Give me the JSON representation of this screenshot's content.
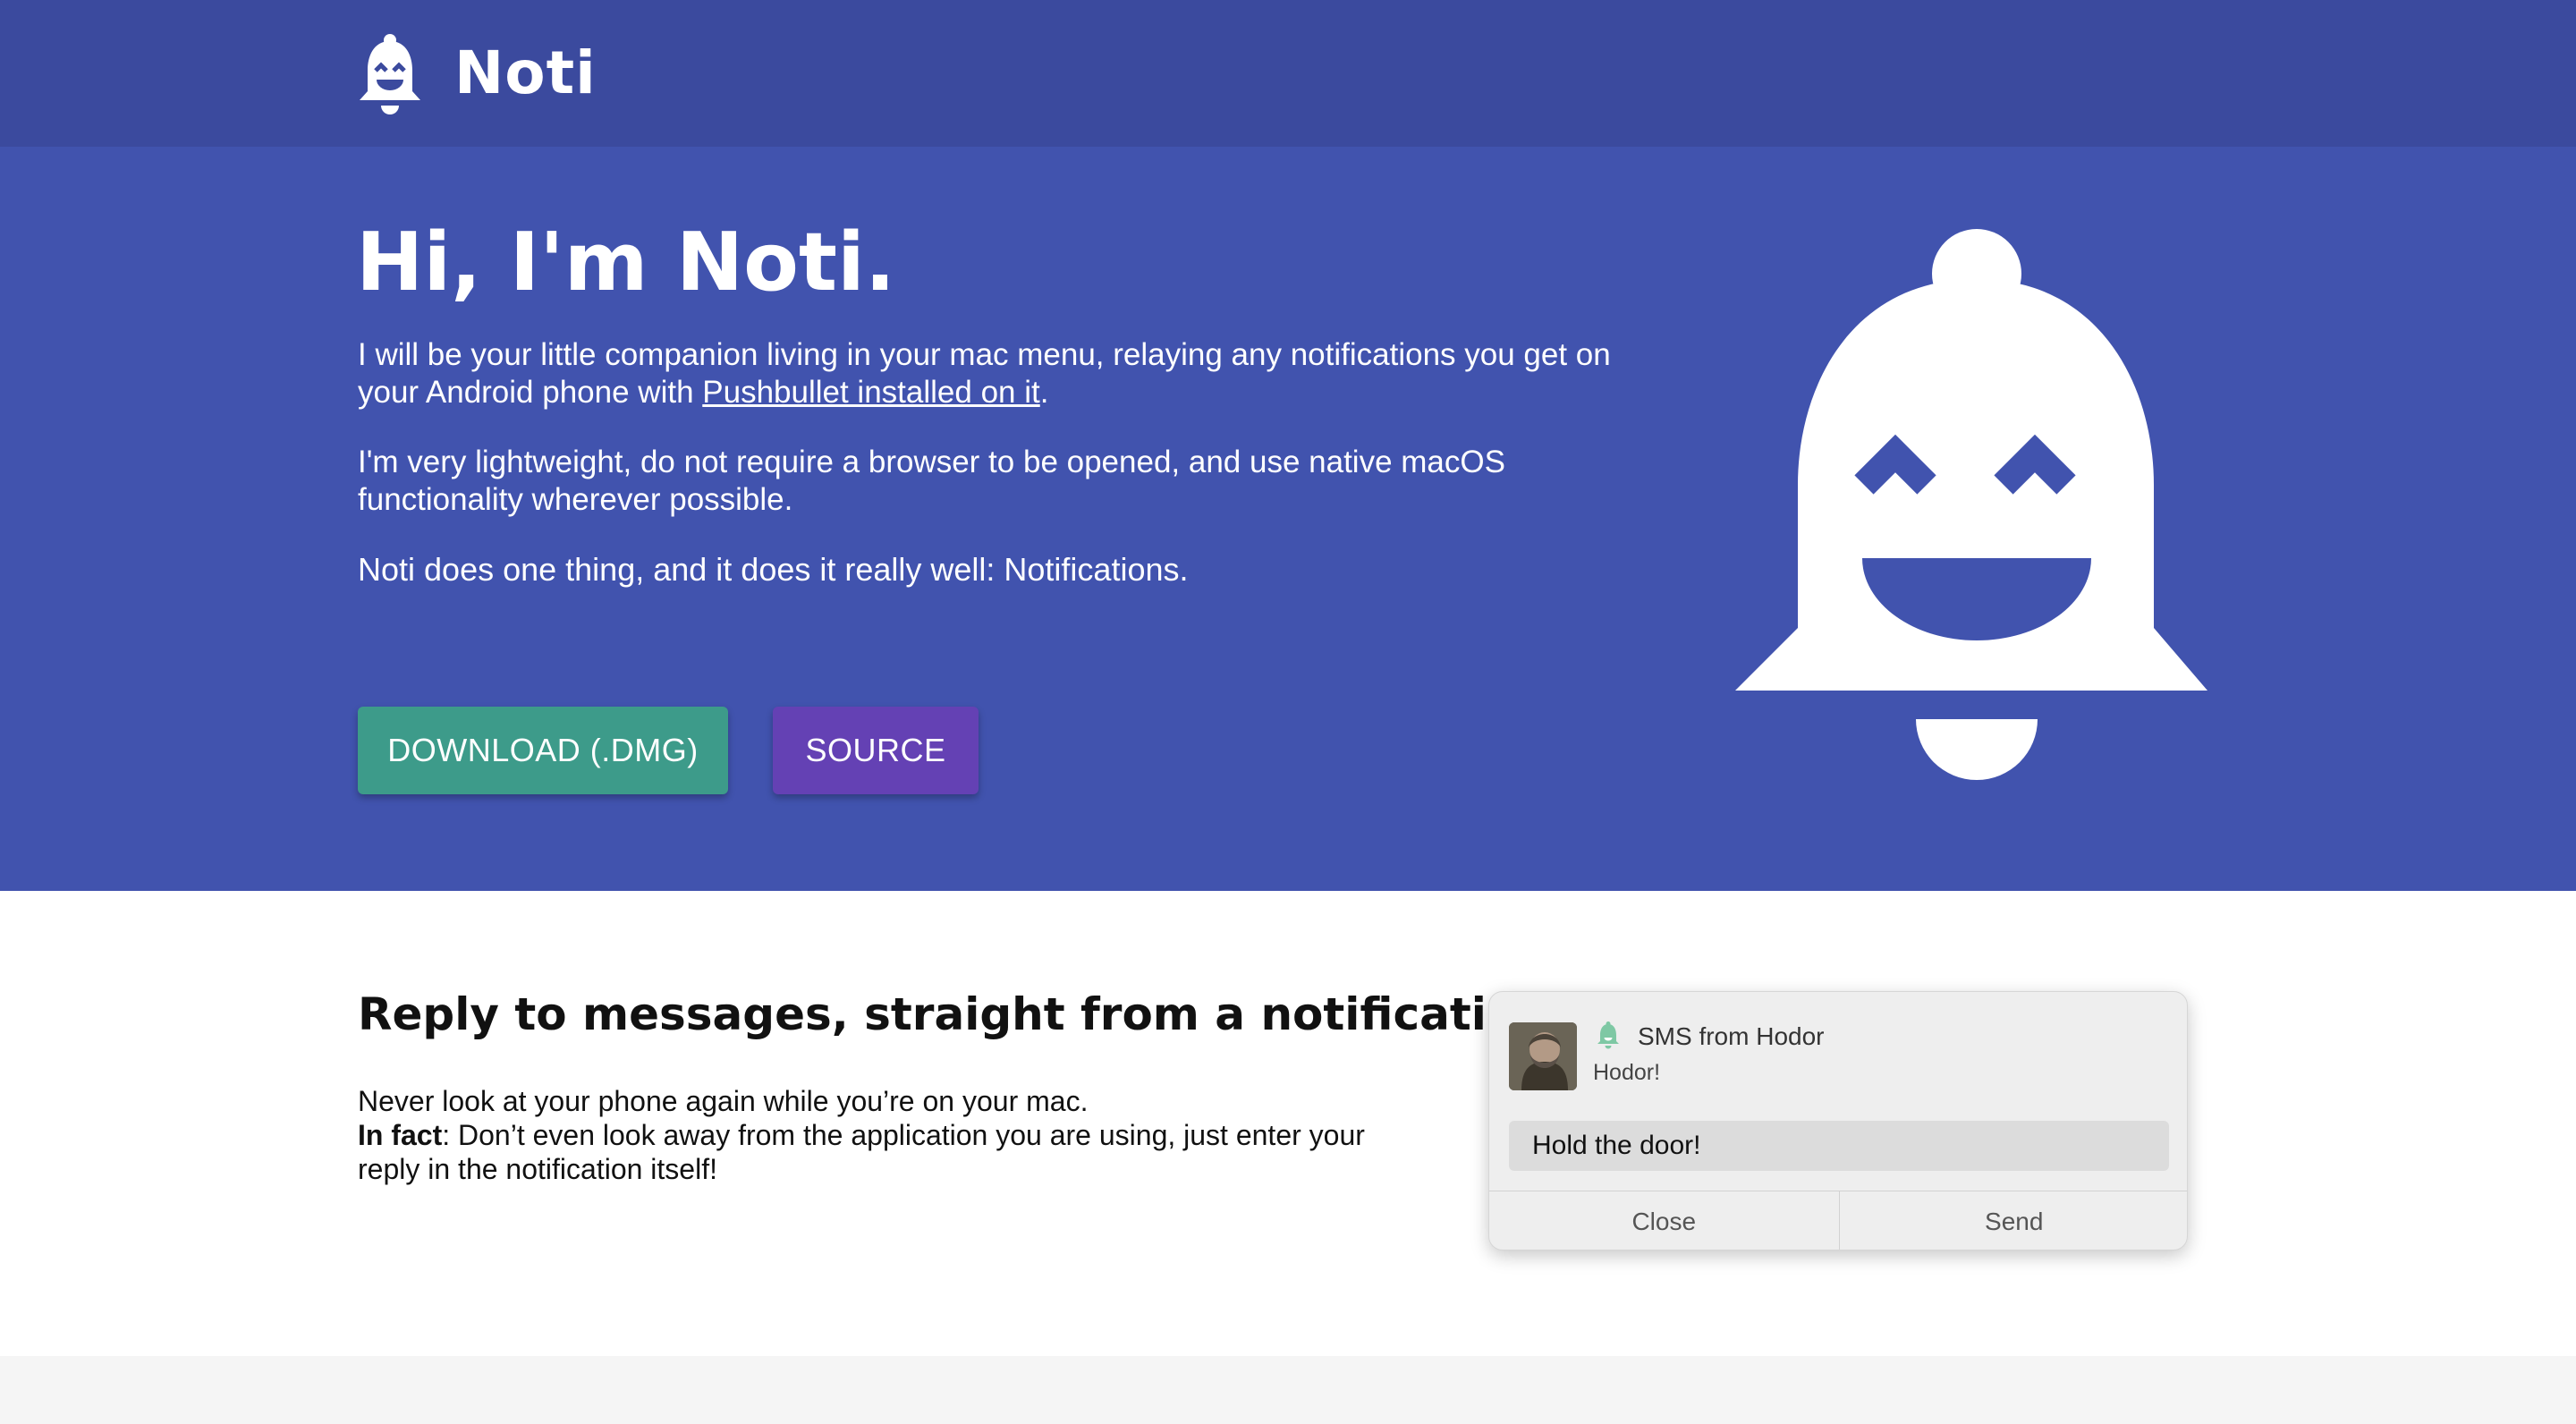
{
  "colors": {
    "topbar": "#3b4a9e",
    "hero": "#4153ae",
    "download_button": "#3d9b8a",
    "source_button": "#6441b4",
    "notification_icon": "#7ec8a4"
  },
  "header": {
    "logo_icon": "bell-mascot-icon",
    "app_name": "Noti"
  },
  "hero": {
    "title": "Hi, I'm Noti.",
    "p1_before_link": "I will be your little companion living in your mac menu, relaying any notifications you get on your Android phone with ",
    "p1_link": "Pushbullet installed on it",
    "p1_after_link": ".",
    "p2": "I'm very lightweight, do not require a browser to be opened, and use native macOS functionality wherever possible.",
    "p3": "Noti does one thing, and it does it really well: Notifications.",
    "download_label": "DOWNLOAD (.DMG)",
    "source_label": "SOURCE",
    "mascot_icon": "bell-mascot-icon"
  },
  "feature": {
    "title": "Reply to messages, straight from a notification.",
    "line1": "Never look at your phone again while you’re on your mac.",
    "emphasis": "In fact",
    "line2": ": Don’t even look away from the application you are using, just enter your reply in the notification itself!"
  },
  "notification": {
    "title": "SMS from Hodor",
    "body": "Hodor!",
    "reply_value": "Hold the door!",
    "close_label": "Close",
    "send_label": "Send",
    "avatar": "contact-avatar",
    "app_icon": "bell-icon"
  }
}
